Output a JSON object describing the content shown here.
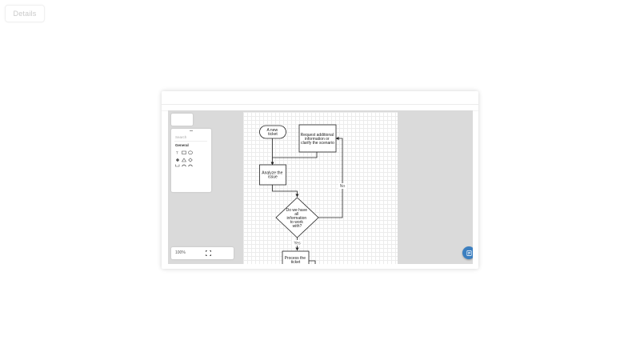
{
  "details_button": {
    "label": "Details"
  },
  "editor": {
    "palette": {
      "search_placeholder": "Search",
      "section_title": "General",
      "shape_icons": [
        "text-icon",
        "rectangle-icon",
        "ellipse-icon",
        "cross-icon",
        "triangle-icon",
        "diamond-icon",
        "bracket-icon",
        "arc-icon",
        "arc-icon"
      ]
    },
    "zoom": {
      "level": "100%"
    }
  },
  "diagram": {
    "nodes": {
      "start": {
        "lines": [
          "A new",
          "ticket"
        ]
      },
      "request": {
        "lines": [
          "Request additional",
          "information or",
          "clarify the scenario"
        ]
      },
      "analyze": {
        "lines": [
          "Analyze the",
          "issue"
        ]
      },
      "decision": {
        "lines": [
          "Do we have",
          "all",
          "information",
          "to work",
          "with?"
        ]
      },
      "process": {
        "lines": [
          "Process the",
          "ticket"
        ]
      }
    },
    "edge_labels": {
      "no": "No",
      "yes": "Yes"
    }
  },
  "colors": {
    "fab": "#3c7fc0",
    "canvas_background": "#dadada",
    "line": "#222222"
  },
  "icons": {
    "fab": "note-icon",
    "fit": "fit-screen-icon"
  }
}
